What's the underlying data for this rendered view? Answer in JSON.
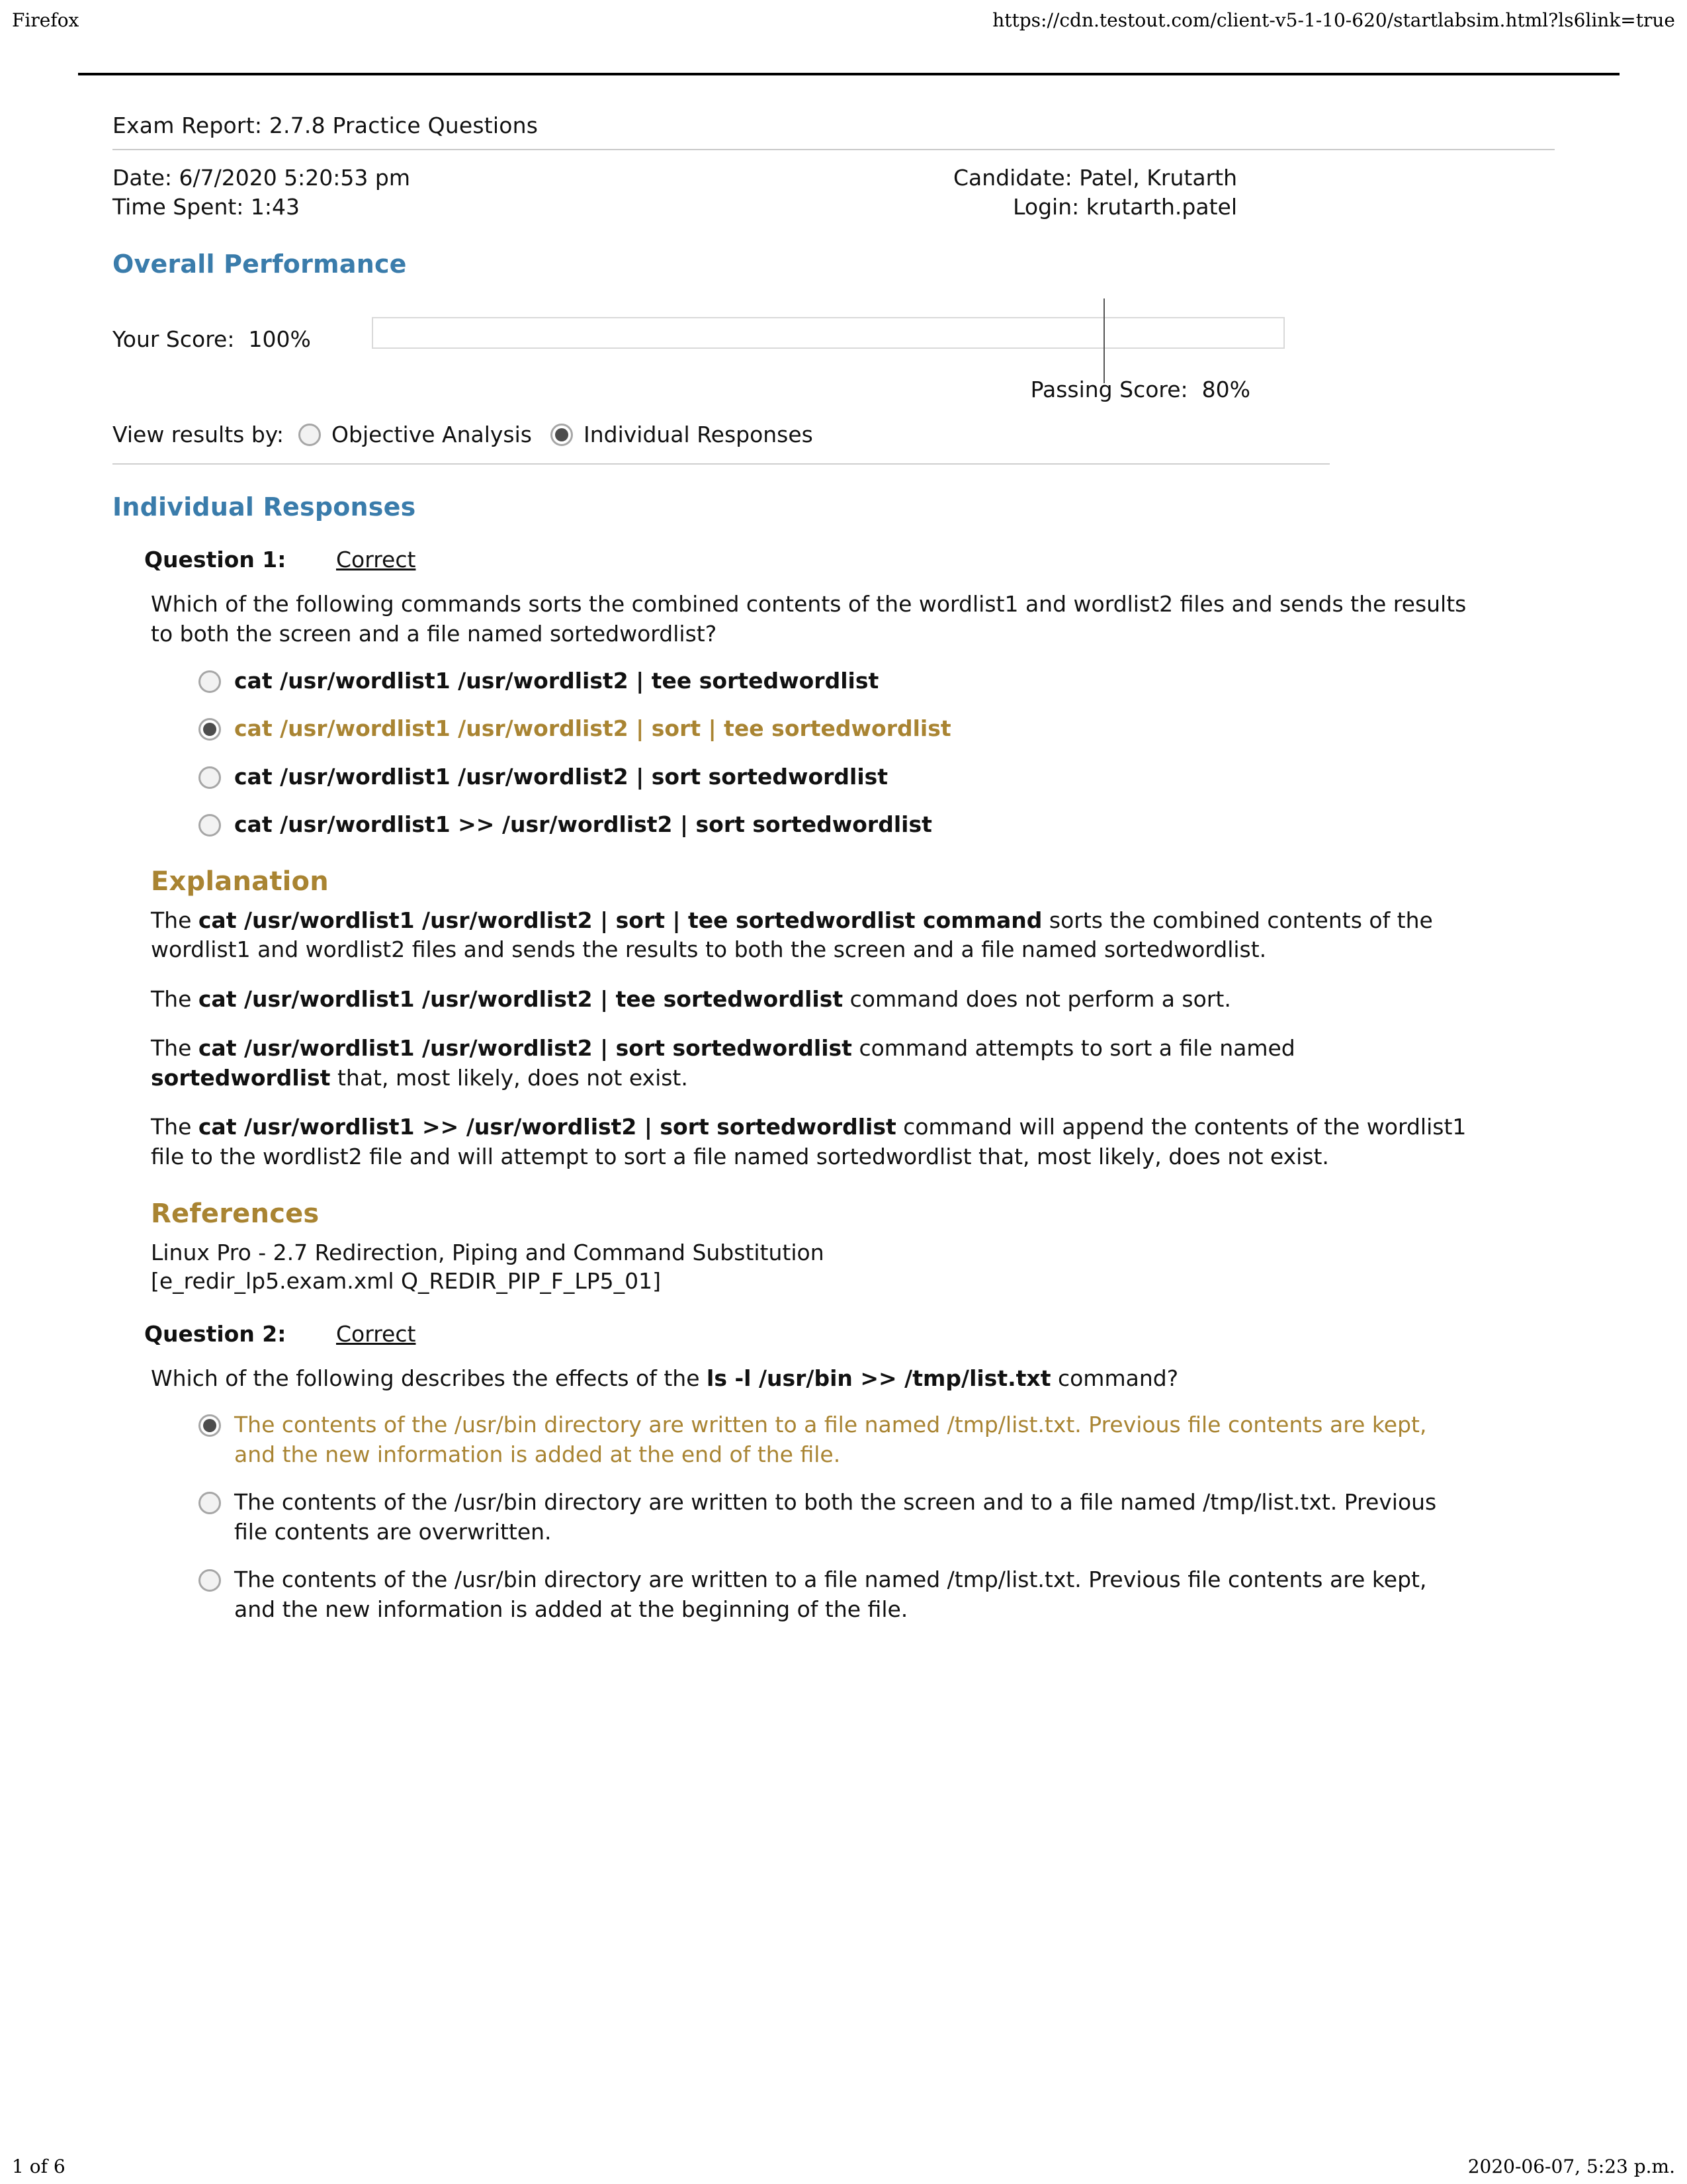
{
  "browser": {
    "app_name": "Firefox",
    "url": "https://cdn.testout.com/client-v5-1-10-620/startlabsim.html?ls6link=true",
    "footer_page": "1 of 6",
    "footer_timestamp": "2020-06-07, 5:23 p.m."
  },
  "colors": {
    "heading_blue": "#3a7cab",
    "accent_gold": "#a98432",
    "text": "#111111"
  },
  "report": {
    "title": "Exam Report: 2.7.8 Practice Questions",
    "date_label": "Date: 6/7/2020 5:20:53 pm",
    "time_spent_label": "Time Spent: 1:43",
    "candidate_label": "Candidate: Patel, Krutarth",
    "login_label": "Login: krutarth.patel"
  },
  "overall_performance": {
    "heading": "Overall Performance",
    "your_score_label": "Your Score:  100%",
    "your_score_value": 100,
    "passing_score_label": "Passing Score:  80%",
    "passing_score_value": 80
  },
  "view_results": {
    "label": "View results by:",
    "options": [
      {
        "label": "Objective Analysis",
        "selected": false
      },
      {
        "label": "Individual Responses",
        "selected": true
      }
    ]
  },
  "individual_responses": {
    "heading": "Individual Responses",
    "questions": [
      {
        "number_label": "Question 1:",
        "result_label": "Correct",
        "prompt": "Which of the following commands sorts the combined contents of the wordlist1 and wordlist2 files and sends the results to both the screen and a file named sortedwordlist?",
        "answers": [
          {
            "text": "cat /usr/wordlist1 /usr/wordlist2 | tee sortedwordlist",
            "selected": false,
            "bold": true
          },
          {
            "text": "cat /usr/wordlist1 /usr/wordlist2 | sort | tee sortedwordlist",
            "selected": true,
            "bold": true
          },
          {
            "text": "cat /usr/wordlist1 /usr/wordlist2 | sort sortedwordlist",
            "selected": false,
            "bold": true
          },
          {
            "text": "cat /usr/wordlist1 >> /usr/wordlist2 | sort sortedwordlist",
            "selected": false,
            "bold": true
          }
        ],
        "explanation_heading": "Explanation",
        "explanation_paragraphs": [
          "The <b>cat /usr/wordlist1 /usr/wordlist2 | sort | tee sortedwordlist command</b> sorts the combined contents of the wordlist1 and wordlist2 files and sends the results to both the screen and a file named sortedwordlist.",
          "The <b>cat /usr/wordlist1 /usr/wordlist2 | tee sortedwordlist</b> command does not perform a sort.",
          "The <b>cat /usr/wordlist1 /usr/wordlist2 | sort sortedwordlist</b> command attempts to sort a file named <b>sortedwordlist</b> that, most likely, does not exist.",
          "The <b>cat /usr/wordlist1 >> /usr/wordlist2 | sort sortedwordlist</b> command will append the contents of the wordlist1 file to the wordlist2 file and will attempt to sort a file named sortedwordlist that, most likely, does not exist."
        ],
        "references_heading": "References",
        "references": [
          "Linux Pro - 2.7 Redirection, Piping and Command Substitution",
          "[e_redir_lp5.exam.xml Q_REDIR_PIP_F_LP5_01]"
        ]
      },
      {
        "number_label": "Question 2:",
        "result_label": "Correct",
        "prompt": "Which of the following describes the effects of the <b>ls -l /usr/bin >> /tmp/list.txt</b> command?",
        "answers": [
          {
            "text": "The contents of the /usr/bin directory are written to a file named /tmp/list.txt. Previous file contents are kept, and the new information is added at the end of the file.",
            "selected": true,
            "bold": false
          },
          {
            "text": "The contents of the /usr/bin directory are written to both the screen and to a file named /tmp/list.txt. Previous file contents are overwritten.",
            "selected": false,
            "bold": false
          },
          {
            "text": "The contents of the /usr/bin directory are written to a file named /tmp/list.txt. Previous file contents are kept, and the new information is added at the beginning of the file.",
            "selected": false,
            "bold": false
          }
        ]
      }
    ]
  }
}
